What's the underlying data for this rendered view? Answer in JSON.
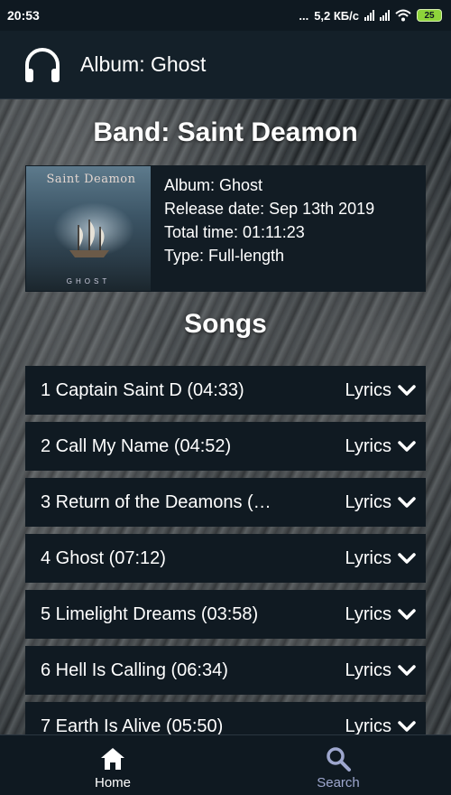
{
  "status_bar": {
    "time": "20:53",
    "dots": "...",
    "speed": "5,2 КБ/с",
    "battery": "25"
  },
  "app_bar": {
    "title": "Album: Ghost",
    "icon": "headphones-icon"
  },
  "band": {
    "title": "Band: Saint Deamon"
  },
  "album": {
    "cover_logo": "Saint Deamon",
    "cover_caption": "GHOST",
    "name": "Album: Ghost",
    "release_date": "Release date: Sep 13th 2019",
    "total_time": "Total time: 01:11:23",
    "type": "Type: Full-length"
  },
  "songs_heading": "Songs",
  "songs": [
    {
      "title": "1 Captain Saint D (04:33)",
      "lyrics_label": "Lyrics"
    },
    {
      "title": "2 Call My Name (04:52)",
      "lyrics_label": "Lyrics"
    },
    {
      "title": "3 Return of the Deamons (…",
      "lyrics_label": "Lyrics"
    },
    {
      "title": "4 Ghost (07:12)",
      "lyrics_label": "Lyrics"
    },
    {
      "title": "5 Limelight Dreams (03:58)",
      "lyrics_label": "Lyrics"
    },
    {
      "title": "6 Hell Is Calling (06:34)",
      "lyrics_label": "Lyrics"
    },
    {
      "title": "7 Earth Is Alive (05:50)",
      "lyrics_label": "Lyrics"
    }
  ],
  "bottom_nav": {
    "home_label": "Home",
    "search_label": "Search",
    "home_icon": "home-icon",
    "search_icon": "search-icon",
    "active_color": "#ffffff",
    "inactive_color": "#9ea7ce"
  },
  "colors": {
    "background": "#0f1921",
    "card": "#101a22",
    "battery": "#8ed43a"
  }
}
